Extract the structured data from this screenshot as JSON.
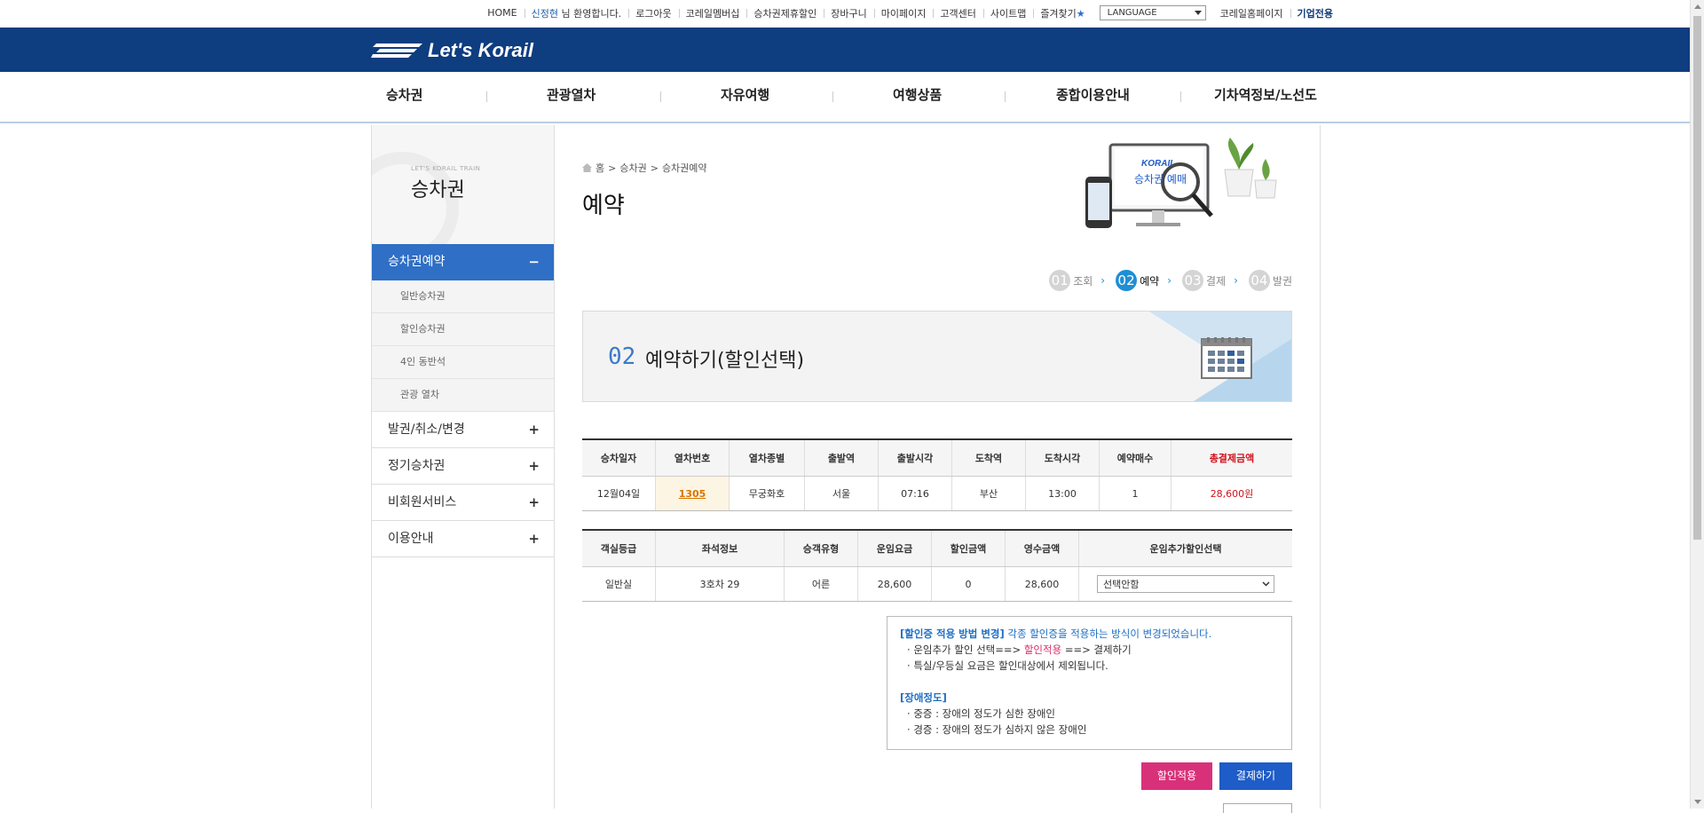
{
  "util": {
    "home": "HOME",
    "user_name": "신정현",
    "welcome": "님 환영합니다.",
    "logout": "로그아웃",
    "membership": "코레일멤버십",
    "partner_discount": "승차권제휴할인",
    "cart": "장바구니",
    "mypage": "마이페이지",
    "customer_center": "고객센터",
    "sitemap": "사이트맵",
    "favorites": "즐겨찾기",
    "language": "LANGUAGE",
    "korail_home": "코레일홈페이지",
    "corporate": "기업전용"
  },
  "brand": {
    "logo": "Let's Korail"
  },
  "gnb": [
    "승차권",
    "관광열차",
    "자유여행",
    "여행상품",
    "종합이용안내",
    "기차역정보/노선도"
  ],
  "lnb": {
    "sub_title": "LET'S KORAIL TRAIN",
    "title": "승차권",
    "active": {
      "label": "승차권예약",
      "toggle": "−"
    },
    "sub_items": [
      "일반승차권",
      "할인승차권",
      "4인 동반석",
      "관광 열차"
    ],
    "items": [
      {
        "label": "발권/취소/변경",
        "toggle": "+"
      },
      {
        "label": "정기승차권",
        "toggle": "+"
      },
      {
        "label": "비회원서비스",
        "toggle": "+"
      },
      {
        "label": "이용안내",
        "toggle": "+"
      }
    ]
  },
  "breadcrumb": [
    "홈",
    "승차권",
    "승차권예약"
  ],
  "page_title": "예약",
  "illustration": {
    "brand": "KORAIL",
    "text": "승차권 예매"
  },
  "steps": [
    {
      "num": "01",
      "label": "조회"
    },
    {
      "num": "02",
      "label": "예약"
    },
    {
      "num": "03",
      "label": "결제"
    },
    {
      "num": "04",
      "label": "발권"
    }
  ],
  "banner": {
    "num": "02",
    "title": "예약하기(할인선택)"
  },
  "train_table": {
    "headers": [
      "승차일자",
      "열차번호",
      "열차종별",
      "출발역",
      "출발시각",
      "도착역",
      "도착시각",
      "예약매수",
      "총결제금액"
    ],
    "row": [
      "12월04일",
      "1305",
      "무궁화호",
      "서울",
      "07:16",
      "부산",
      "13:00",
      "1",
      "28,600원"
    ]
  },
  "seat_table": {
    "headers": [
      "객실등급",
      "좌석정보",
      "승객유형",
      "운임요금",
      "할인금액",
      "영수금액",
      "운임추가할인선택"
    ],
    "row": [
      "일반실",
      "3호차 29",
      "어른",
      "28,600",
      "0",
      "28,600"
    ],
    "select_value": "선택안함"
  },
  "notice": {
    "head": "[할인증 적용 방법 변경]",
    "head_desc": "각종 할인증을 적용하는 방식이 변경되었습니다.",
    "line1_a": "운임추가 할인 선택==>",
    "line1_b": "할인적용",
    "line1_c": "==> 결제하기",
    "line2": "특실/우등실 요금은 할인대상에서 제외됩니다.",
    "head2": "[장애정도]",
    "line3": "중증 : 장애의 정도가 심한 장애인",
    "line4": "경증 : 장애의 정도가 심하지 않은 장애인"
  },
  "buttons": {
    "apply": "할인적용",
    "pay": "결제하기"
  },
  "colors": {
    "brand_navy": "#0e3d80",
    "lnb_active": "#2f6fc6",
    "apply_btn": "#d8317a",
    "pay_btn": "#1e5cc8",
    "total_red": "#d0111b"
  }
}
